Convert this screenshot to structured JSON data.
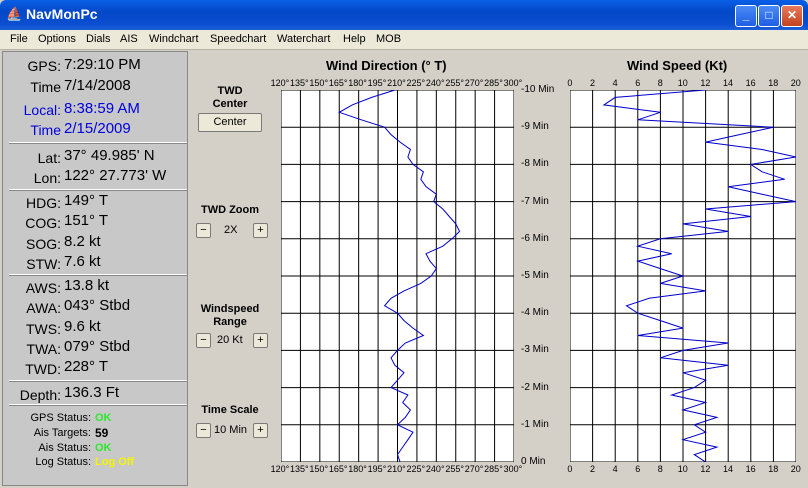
{
  "window": {
    "title": "NavMonPc",
    "minimize": "_",
    "maximize": "□",
    "close": "✕"
  },
  "menu": [
    "File",
    "Options",
    "Dials",
    "AIS",
    "Windchart",
    "Speedchart",
    "Waterchart",
    "Help",
    "MOB"
  ],
  "instruments": {
    "gps": {
      "label": "GPS:",
      "value": "7:29:10 PM"
    },
    "time": {
      "label": "Time",
      "value": "7/14/2008"
    },
    "local": {
      "label": "Local:",
      "value": "8:38:59 AM"
    },
    "local_time": {
      "label": "Time",
      "value": "2/15/2009"
    },
    "lat": {
      "label": "Lat:",
      "value": "37° 49.985' N"
    },
    "lon": {
      "label": "Lon:",
      "value": "122° 27.773' W"
    },
    "hdg": {
      "label": "HDG:",
      "value": "149° T"
    },
    "cog": {
      "label": "COG:",
      "value": "151° T"
    },
    "sog": {
      "label": "SOG:",
      "value": "8.2 kt"
    },
    "stw": {
      "label": "STW:",
      "value": "7.6 kt"
    },
    "aws": {
      "label": "AWS:",
      "value": "13.8 kt"
    },
    "awa": {
      "label": "AWA:",
      "value": "043° Stbd"
    },
    "tws": {
      "label": "TWS:",
      "value": "9.6 kt"
    },
    "twa": {
      "label": "TWA:",
      "value": "079° Stbd"
    },
    "twd": {
      "label": "TWD:",
      "value": "228° T"
    },
    "depth": {
      "label": "Depth:",
      "value": "136.3 Ft"
    },
    "gps_status": {
      "label": "GPS Status:",
      "value": "OK"
    },
    "ais_targets": {
      "label": "Ais Targets:",
      "value": "59"
    },
    "ais_status": {
      "label": "Ais Status:",
      "value": "OK"
    },
    "log_status": {
      "label": "Log Status:",
      "value": "Log Off"
    }
  },
  "controls": {
    "twd_center": {
      "title": "TWD\nCenter",
      "button": "Center"
    },
    "twd_zoom": {
      "title": "TWD Zoom",
      "value": "2X"
    },
    "windspeed_range": {
      "title": "Windspeed\nRange",
      "value": "20 Kt"
    },
    "time_scale": {
      "title": "Time Scale",
      "value": "10 Min"
    },
    "minus": "−",
    "plus": "+"
  },
  "chart_data": [
    {
      "type": "line",
      "title": "Wind Direction (° T)",
      "xlim": [
        120,
        300
      ],
      "x_ticks": [
        "120°",
        "135°",
        "150°",
        "165°",
        "180°",
        "195°",
        "210°",
        "225°",
        "240°",
        "255°",
        "270°",
        "285°",
        "300°"
      ],
      "y_ticks": [
        "-10 Min",
        "-9 Min",
        "-8 Min",
        "-7 Min",
        "-6 Min",
        "-5 Min",
        "-4 Min",
        "-3 Min",
        "-2 Min",
        "-1 Min",
        "0 Min"
      ],
      "series": [
        {
          "minutes": [
            -10,
            -9.8,
            -9.6,
            -9.4,
            -9.2,
            -9,
            -8.8,
            -8.6,
            -8.4,
            -8.2,
            -8,
            -7.8,
            -7.6,
            -7.4,
            -7.2,
            -7,
            -6.8,
            -6.6,
            -6.4,
            -6.2,
            -6,
            -5.8,
            -5.6,
            -5.4,
            -5.2,
            -5,
            -4.8,
            -4.6,
            -4.4,
            -4.2,
            -4,
            -3.8,
            -3.6,
            -3.4,
            -3.2,
            -3,
            -2.8,
            -2.6,
            -2.4,
            -2.2,
            -2,
            -1.8,
            -1.6,
            -1.4,
            -1.2,
            -1,
            -0.8,
            -0.6,
            -0.4,
            -0.2,
            0
          ],
          "values": [
            208,
            190,
            175,
            165,
            182,
            200,
            205,
            212,
            220,
            218,
            222,
            230,
            228,
            232,
            240,
            238,
            245,
            250,
            255,
            258,
            252,
            245,
            232,
            235,
            240,
            236,
            228,
            215,
            205,
            200,
            210,
            215,
            222,
            230,
            216,
            210,
            205,
            208,
            215,
            210,
            205,
            218,
            214,
            220,
            216,
            210,
            222,
            218,
            214,
            210,
            212
          ]
        }
      ]
    },
    {
      "type": "line",
      "title": "Wind Speed (Kt)",
      "xlim": [
        0,
        20
      ],
      "x_ticks": [
        "0",
        "2",
        "4",
        "6",
        "8",
        "10",
        "12",
        "14",
        "16",
        "18",
        "20"
      ],
      "y_ticks": [
        "-10 Min",
        "-9 Min",
        "-8 Min",
        "-7 Min",
        "-6 Min",
        "-5 Min",
        "-4 Min",
        "-3 Min",
        "-2 Min",
        "-1 Min",
        "0 Min"
      ],
      "series": [
        {
          "minutes": [
            -10,
            -9.8,
            -9.6,
            -9.4,
            -9.2,
            -9,
            -8.8,
            -8.6,
            -8.4,
            -8.2,
            -8,
            -7.8,
            -7.6,
            -7.4,
            -7.2,
            -7,
            -6.8,
            -6.6,
            -6.4,
            -6.2,
            -6,
            -5.8,
            -5.6,
            -5.4,
            -5.2,
            -5,
            -4.8,
            -4.6,
            -4.4,
            -4.2,
            -4,
            -3.8,
            -3.6,
            -3.4,
            -3.2,
            -3,
            -2.8,
            -2.6,
            -2.4,
            -2.2,
            -2,
            -1.8,
            -1.6,
            -1.4,
            -1.2,
            -1,
            -0.8,
            -0.6,
            -0.4,
            -0.2,
            0
          ],
          "values": [
            12,
            4,
            3,
            8,
            6,
            18,
            15,
            12,
            17,
            20,
            16,
            17,
            19,
            14,
            17,
            20,
            12,
            16,
            10,
            14,
            8,
            6,
            9,
            6,
            8,
            10,
            8,
            12,
            7,
            5,
            6,
            8,
            10,
            6,
            14,
            10,
            8,
            14,
            10,
            12,
            11,
            9,
            12,
            10,
            13,
            11,
            12,
            10,
            13,
            11,
            12
          ]
        }
      ]
    }
  ]
}
